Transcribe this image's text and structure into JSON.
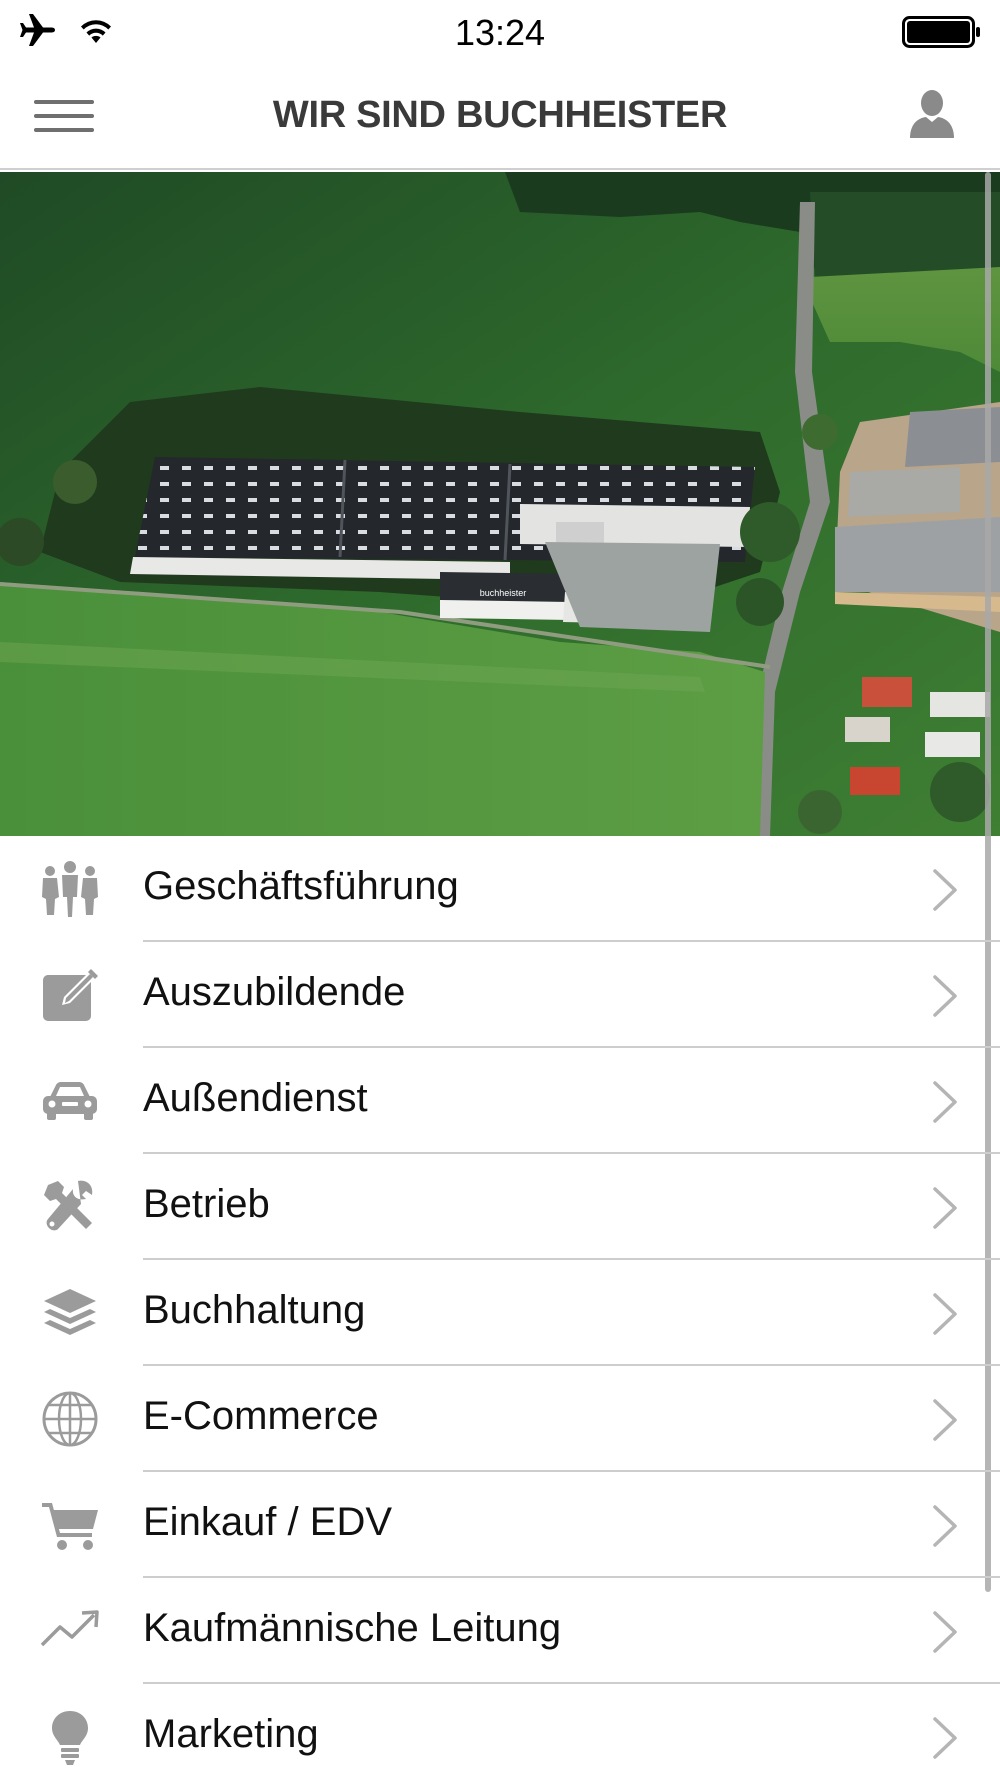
{
  "status_bar": {
    "time": "13:24",
    "icons": [
      "airplane-icon",
      "wifi-icon",
      "battery-icon"
    ]
  },
  "nav": {
    "title": "WIR SIND BUCHHEISTER",
    "left_icon": "hamburger-menu-icon",
    "right_icon": "profile-icon"
  },
  "hero": {
    "sign_text": "buchheister"
  },
  "menu": {
    "items": [
      {
        "label": "Geschäftsführung",
        "icon": "people-icon"
      },
      {
        "label": "Auszubildende",
        "icon": "edit-icon"
      },
      {
        "label": "Außendienst",
        "icon": "car-icon"
      },
      {
        "label": "Betrieb",
        "icon": "tools-icon"
      },
      {
        "label": "Buchhaltung",
        "icon": "layers-icon"
      },
      {
        "label": "E-Commerce",
        "icon": "globe-icon"
      },
      {
        "label": "Einkauf / EDV",
        "icon": "cart-icon"
      },
      {
        "label": "Kaufmännische Leitung",
        "icon": "trend-icon"
      },
      {
        "label": "Marketing",
        "icon": "lightbulb-icon"
      }
    ]
  },
  "colors": {
    "icon_gray": "#9b9b9b",
    "title_gray": "#3a3a3a",
    "separator": "#cdcdcd",
    "chevron": "#b5b5b5"
  }
}
